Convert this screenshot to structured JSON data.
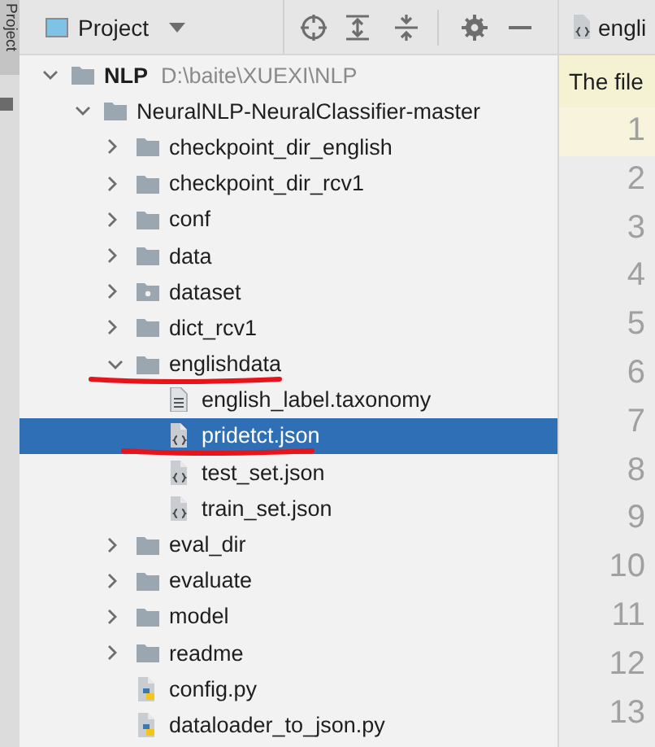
{
  "side_tab": {
    "label": "Project"
  },
  "panel": {
    "title": "Project"
  },
  "tree": [
    {
      "label": "NLP",
      "kind": "root",
      "path": "D:\\baite\\XUEXI\\NLP",
      "expanded": true,
      "selected": false,
      "marked": false,
      "children": [
        {
          "label": "NeuralNLP-NeuralClassifier-master",
          "kind": "folder",
          "expanded": true,
          "selected": false,
          "marked": false,
          "children": [
            {
              "label": "checkpoint_dir_english",
              "kind": "folder",
              "expanded": false,
              "selected": false,
              "marked": false
            },
            {
              "label": "checkpoint_dir_rcv1",
              "kind": "folder",
              "expanded": false,
              "selected": false,
              "marked": false
            },
            {
              "label": "conf",
              "kind": "folder",
              "expanded": false,
              "selected": false,
              "marked": false
            },
            {
              "label": "data",
              "kind": "folder",
              "expanded": false,
              "selected": false,
              "marked": false
            },
            {
              "label": "dataset",
              "kind": "package",
              "expanded": false,
              "selected": false,
              "marked": false
            },
            {
              "label": "dict_rcv1",
              "kind": "folder",
              "expanded": false,
              "selected": false,
              "marked": false
            },
            {
              "label": "englishdata",
              "kind": "folder",
              "expanded": true,
              "selected": false,
              "marked": true,
              "children": [
                {
                  "label": "english_label.taxonomy",
                  "kind": "text",
                  "selected": false,
                  "marked": false
                },
                {
                  "label": "pridetct.json",
                  "kind": "json",
                  "selected": true,
                  "marked": true
                },
                {
                  "label": "test_set.json",
                  "kind": "json",
                  "selected": false,
                  "marked": false
                },
                {
                  "label": "train_set.json",
                  "kind": "json",
                  "selected": false,
                  "marked": false
                }
              ]
            },
            {
              "label": "eval_dir",
              "kind": "folder",
              "expanded": false,
              "selected": false,
              "marked": false
            },
            {
              "label": "evaluate",
              "kind": "folder",
              "expanded": false,
              "selected": false,
              "marked": false
            },
            {
              "label": "model",
              "kind": "folder",
              "expanded": false,
              "selected": false,
              "marked": false
            },
            {
              "label": "readme",
              "kind": "folder",
              "expanded": false,
              "selected": false,
              "marked": false
            },
            {
              "label": "config.py",
              "kind": "python",
              "selected": false,
              "marked": false
            },
            {
              "label": "dataloader_to_json.py",
              "kind": "python",
              "selected": false,
              "marked": false
            }
          ]
        }
      ]
    }
  ],
  "editor": {
    "tab": "engli",
    "notice": "The file",
    "line_numbers": [
      "1",
      "2",
      "3",
      "4",
      "5",
      "6",
      "7",
      "8",
      "9",
      "10",
      "11",
      "12",
      "13"
    ]
  }
}
